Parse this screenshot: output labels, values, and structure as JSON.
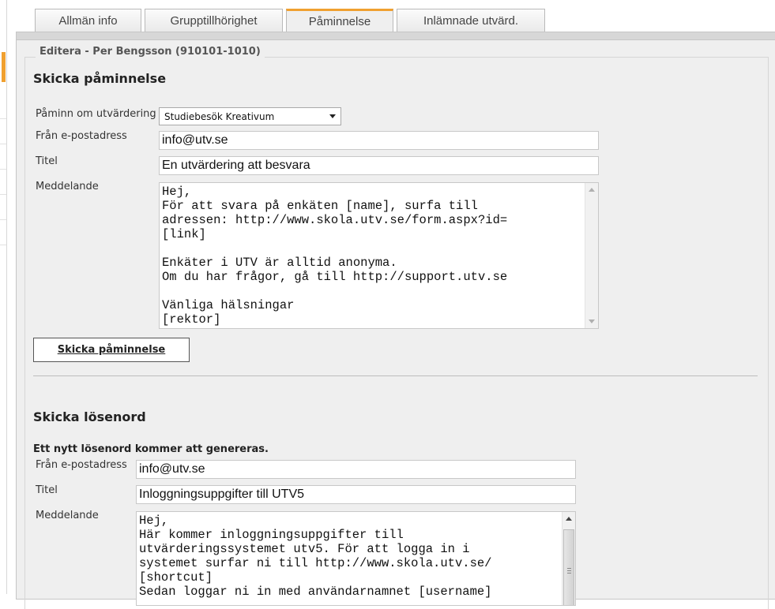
{
  "tabs": [
    {
      "label": "Allmän info",
      "active": false
    },
    {
      "label": "Grupptillhörighet",
      "active": false
    },
    {
      "label": "Påminnelse",
      "active": true
    },
    {
      "label": "Inlämnade utvärd.",
      "active": false
    }
  ],
  "legend": "Editera - Per Bengsson (910101-1010)",
  "reminder": {
    "heading": "Skicka påminnelse",
    "evaluation_label": "Påminn om utvärdering",
    "evaluation_value": "Studiebesök Kreativum",
    "from_label": "Från e-postadress",
    "from_value": "info@utv.se",
    "title_label": "Titel",
    "title_value": "En utvärdering att besvara",
    "message_label": "Meddelande",
    "message_value": "Hej,\nFör att svara på enkäten [name], surfa till\nadressen: http://www.skola.utv.se/form.aspx?id=\n[link]\n\nEnkäter i UTV är alltid anonyma.\nOm du har frågor, gå till http://support.utv.se\n\nVänliga hälsningar\n[rektor]",
    "send_button": "Skicka påminnelse"
  },
  "password": {
    "heading": "Skicka lösenord",
    "note": "Ett nytt lösenord kommer att genereras.",
    "from_label": "Från e-postadress",
    "from_value": "info@utv.se",
    "title_label": "Titel",
    "title_value": "Inloggningsuppgifter till UTV5",
    "message_label": "Meddelande",
    "message_value": "Hej,\nHär kommer inloggningsuppgifter till\nutvärderingssystemet utv5. För att logga in i\nsystemet surfar ni till http://www.skola.utv.se/\n[shortcut]\nSedan loggar ni in med användarnamnet [username]"
  },
  "colors": {
    "tab_accent": "#f0a030",
    "panel_background": "#efefef"
  }
}
